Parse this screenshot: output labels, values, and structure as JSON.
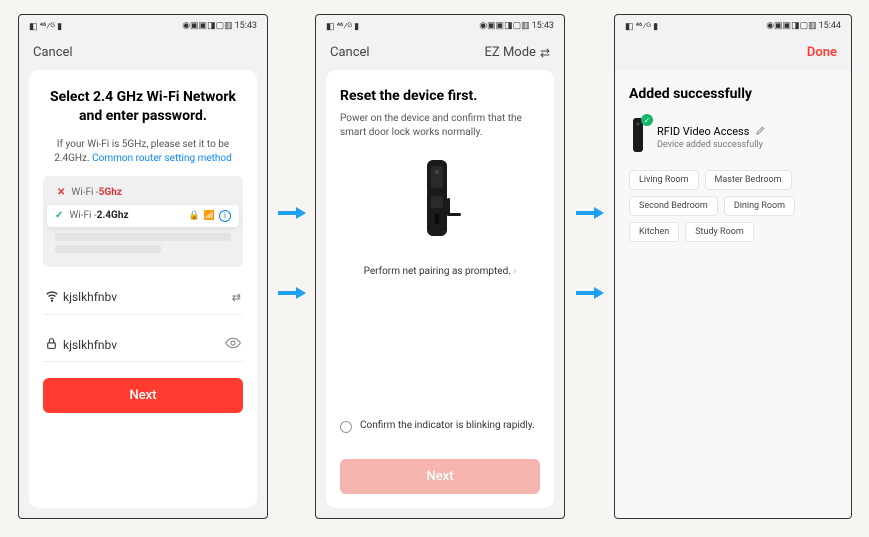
{
  "status": {
    "left_icons": "◧ ⁴⁶⁄ᴳ ▮",
    "right_icons": "◉▣▣◨▢▥",
    "time": "15:43",
    "time_s3": "15:44"
  },
  "screen1": {
    "nav": {
      "cancel": "Cancel"
    },
    "title": "Select 2.4 GHz Wi-Fi Network and enter password.",
    "subtitle_prefix": "If your Wi-Fi is 5GHz, please set it to be 2.4GHz. ",
    "subtitle_link": "Common router setting method",
    "wifi_bad": {
      "mark": "✕",
      "prefix": "Wi-Fi - ",
      "freq": "5Ghz"
    },
    "wifi_good": {
      "mark": "✓",
      "prefix": "Wi-Fi - ",
      "freq": "2.4Ghz"
    },
    "ssid_field": "kjslkhfnbv",
    "password_field": "kjslkhfnbv",
    "next_button": "Next"
  },
  "screen2": {
    "nav": {
      "cancel": "Cancel",
      "mode": "EZ Mode"
    },
    "title": "Reset the device first.",
    "subtitle": "Power on the device and confirm that the smart door lock works normally.",
    "pairing_text": "Perform net pairing as prompted.",
    "confirm_text": "Confirm the indicator is blinking rapidly.",
    "next_button": "Next"
  },
  "screen3": {
    "nav": {
      "done": "Done"
    },
    "title": "Added successfully",
    "device_name": "RFID Video Access",
    "device_status": "Device added successfully",
    "rooms": [
      "Living Room",
      "Master Bedroom",
      "Second Bedroom",
      "Dining Room",
      "Kitchen",
      "Study Room"
    ]
  },
  "arrow_color": "#1ea0f0"
}
